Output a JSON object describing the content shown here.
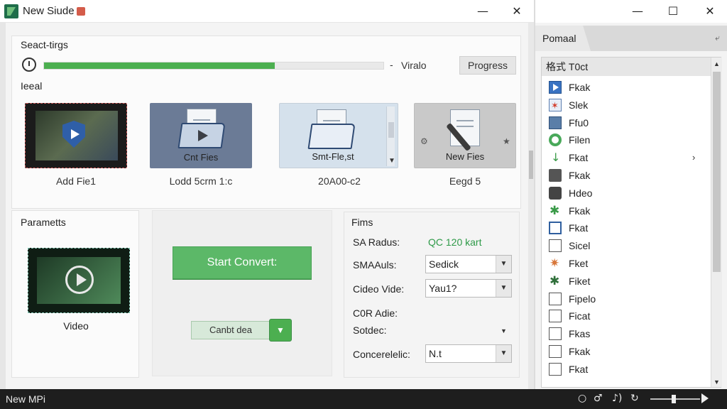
{
  "window": {
    "title": "New Siude",
    "minimize": "—",
    "close": "✕"
  },
  "settings": {
    "label": "Seact-tirgs",
    "progress": 0.68,
    "separator": "-",
    "video_label": "Viralo",
    "progress_button": "Progress",
    "head_label": "Ieeal"
  },
  "tiles": [
    {
      "caption": "Add Fie1",
      "inner": ""
    },
    {
      "caption": "Lodd 5crm 1:c",
      "inner": "Cnt Fies"
    },
    {
      "caption": "20A00-c2",
      "inner": "Smt-Fle,st"
    },
    {
      "caption": "Eegd 5",
      "inner": "New Fies"
    }
  ],
  "parameters": {
    "label": "Parametts",
    "video_label": "Video"
  },
  "center": {
    "start_button": "Start Convert:",
    "split_button": "Canbt dea",
    "split_dropdown": "▼"
  },
  "films": {
    "label": "Fims",
    "rows": [
      {
        "label": "SA Radus:",
        "value": "QC 120 kart"
      },
      {
        "label": "SMAAuls:",
        "value": "Sedick"
      },
      {
        "label": "Cideo Vide:",
        "value": "Yau1?"
      },
      {
        "label": "C0R Adie:",
        "value": ""
      },
      {
        "label": "Sotdec:",
        "value": ""
      },
      {
        "label": "Concerelelic:",
        "value": "N.t"
      }
    ]
  },
  "side_panel": {
    "minimize": "—",
    "maximize": "☐",
    "close": "✕",
    "tab": "Pomaal",
    "pin": "⤶",
    "header": "格式 T0ct",
    "items": [
      {
        "label": "Fkak",
        "icon": "play-icon"
      },
      {
        "label": "Slek",
        "icon": "red-asterisk-icon"
      },
      {
        "label": "Ffu0",
        "icon": "film-icon"
      },
      {
        "label": "Filen",
        "icon": "green-circle-icon"
      },
      {
        "label": "Fkat",
        "icon": "green-arrow-icon",
        "has_submenu": true
      },
      {
        "label": "Fkak",
        "icon": "printer-icon"
      },
      {
        "label": "Hdeo",
        "icon": "camera-icon"
      },
      {
        "label": "Fkak",
        "icon": "green-star-icon"
      },
      {
        "label": "Fkat",
        "icon": "document-icon"
      },
      {
        "label": "Sicel",
        "icon": "checkbox-icon"
      },
      {
        "label": "Fket",
        "icon": "orange-star-icon"
      },
      {
        "label": "Fiket",
        "icon": "dark-star-icon"
      },
      {
        "label": "Fipelo",
        "icon": "checkbox-icon"
      },
      {
        "label": "Ficat",
        "icon": "checkbox-icon"
      },
      {
        "label": "Fkas",
        "icon": "checkbox-icon"
      },
      {
        "label": "Fkak",
        "icon": "checkbox-icon"
      },
      {
        "label": "Fkat",
        "icon": "checkbox-icon"
      }
    ]
  },
  "taskbar": {
    "label": "New MPi",
    "tray_icons": [
      "○",
      "♂",
      "♪)",
      "↻"
    ]
  },
  "colors": {
    "accent": "#4caf50",
    "start_button": "#5cb868",
    "green_text": "#2e9a48"
  }
}
